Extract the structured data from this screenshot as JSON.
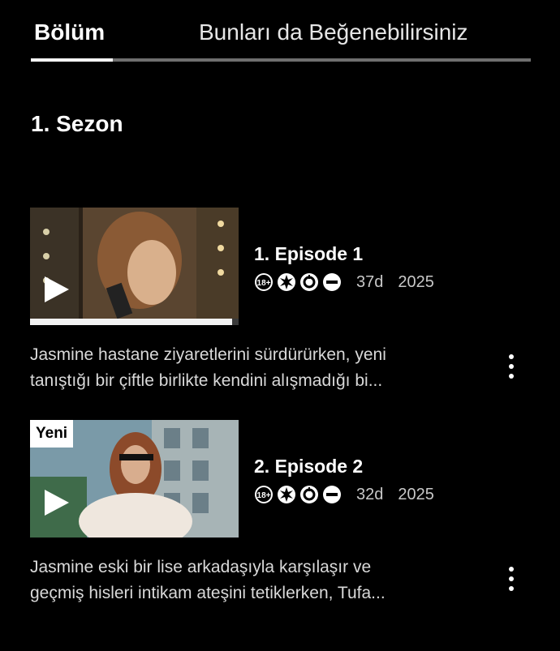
{
  "tabs": [
    {
      "label": "Bölüm",
      "active": true
    },
    {
      "label": "Bunları da Beğenebilirsiniz",
      "active": false
    }
  ],
  "season": {
    "title": "1. Sezon"
  },
  "episodes": [
    {
      "title": "1. Episode 1",
      "ratings": [
        "18+",
        "violence-icon",
        "drugs-icon",
        "restricted-icon"
      ],
      "rating_label": "18+",
      "duration": "37d",
      "year": "2025",
      "synopsis_line1": "Jasmine hastane ziyaretlerini sürdürürken, yeni",
      "synopsis_line2": "tanıştığı bir çiftle birlikte kendini alışmadığı bi...",
      "watched_fraction": 0.97,
      "badge": ""
    },
    {
      "title": "2. Episode 2",
      "ratings": [
        "18+",
        "violence-icon",
        "drugs-icon",
        "restricted-icon"
      ],
      "rating_label": "18+",
      "duration": "32d",
      "year": "2025",
      "synopsis_line1": "Jasmine eski bir lise arkadaşıyla karşılaşır ve",
      "synopsis_line2": "geçmiş hisleri intikam ateşini tetiklerken, Tufa...",
      "watched_fraction": 0,
      "badge": "Yeni"
    }
  ]
}
